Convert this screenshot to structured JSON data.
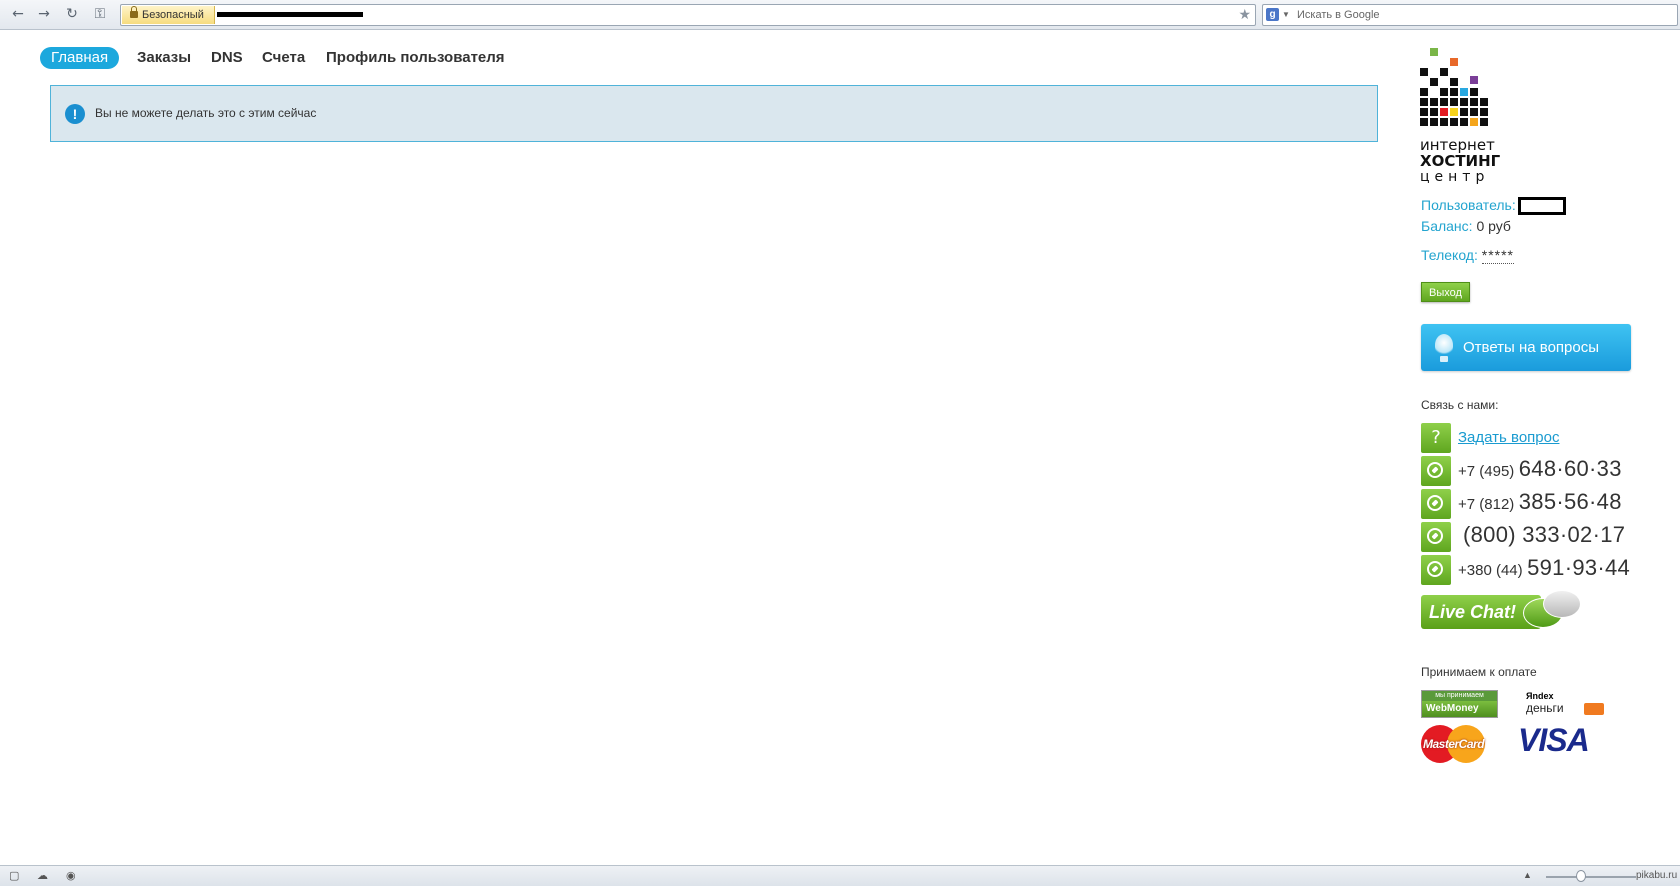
{
  "browser": {
    "secure_label": "Безопасный",
    "search_placeholder": "Искать в Google",
    "search_engine_letter": "g"
  },
  "nav": {
    "items": [
      {
        "label": "Главная",
        "active": true
      },
      {
        "label": "Заказы"
      },
      {
        "label": "DNS"
      },
      {
        "label": "Счета"
      },
      {
        "label": "Профиль пользователя"
      }
    ]
  },
  "alert": {
    "icon": "!",
    "text": "Вы не можете делать это с этим сейчас"
  },
  "logo": {
    "line1": "интернет",
    "line2": "хостинг",
    "line3": "центр"
  },
  "account": {
    "user_label": "Пользователь:",
    "balance_label": "Баланс:",
    "balance_value": "0 руб",
    "telecode_label": "Телекод:",
    "telecode_value": "*****",
    "logout_label": "Выход"
  },
  "faq_button": "Ответы на вопросы",
  "contact": {
    "title": "Связь с нами:",
    "ask_icon": "?",
    "ask_label": "Задать вопрос",
    "phones": [
      {
        "code": "+7 (495)",
        "number": "648·60·33"
      },
      {
        "code": "+7 (812)",
        "number": "385·56·48"
      },
      {
        "code": "",
        "number": "(800) 333·02·17"
      },
      {
        "code": "+380 (44)",
        "number": "591·93·44"
      }
    ],
    "livechat_label": "Live Chat!"
  },
  "payment": {
    "title": "Принимаем к оплате",
    "webmoney_top": "мы принимаем",
    "webmoney_name": "WebMoney",
    "yandex_brand": "Яndex",
    "yandex_name": "деньги",
    "mastercard": "MasterCard",
    "visa": "VISA"
  },
  "watermark": "pikabu.ru"
}
